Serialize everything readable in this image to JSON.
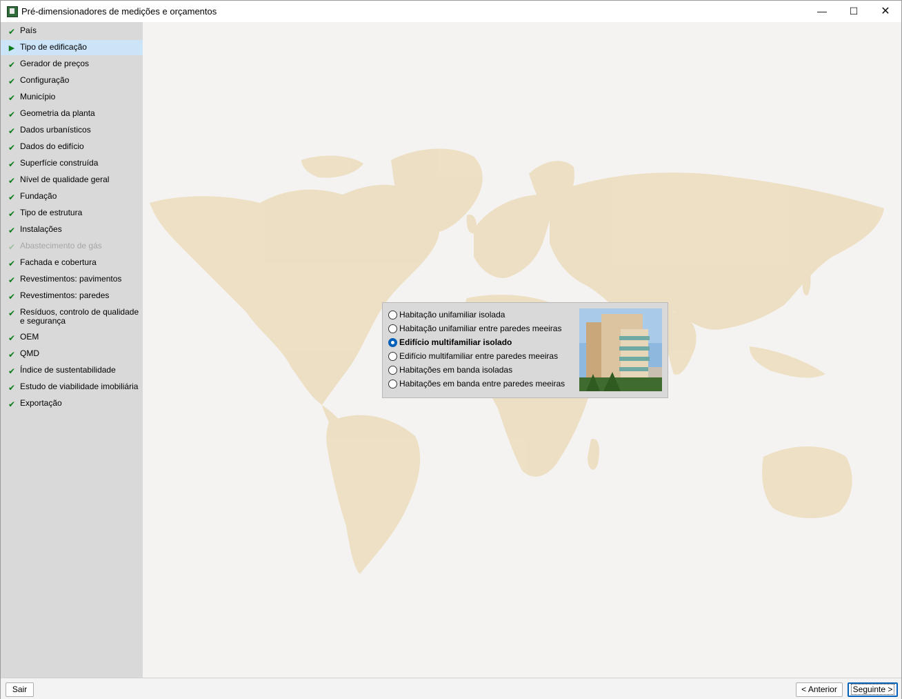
{
  "window": {
    "title": "Pré-dimensionadores de medições e orçamentos",
    "controls": {
      "minimize": "—",
      "maximize": "☐",
      "close": "✕"
    }
  },
  "sidebar": {
    "items": [
      {
        "label": "País",
        "status": "done"
      },
      {
        "label": "Tipo de edificação",
        "status": "current"
      },
      {
        "label": "Gerador de preços",
        "status": "done"
      },
      {
        "label": "Configuração",
        "status": "done"
      },
      {
        "label": "Município",
        "status": "done"
      },
      {
        "label": "Geometria da planta",
        "status": "done"
      },
      {
        "label": "Dados urbanísticos",
        "status": "done"
      },
      {
        "label": "Dados do edifício",
        "status": "done"
      },
      {
        "label": "Superfície construída",
        "status": "done"
      },
      {
        "label": "Nível de qualidade geral",
        "status": "done"
      },
      {
        "label": "Fundação",
        "status": "done"
      },
      {
        "label": "Tipo de estrutura",
        "status": "done"
      },
      {
        "label": "Instalações",
        "status": "done"
      },
      {
        "label": "Abastecimento de gás",
        "status": "disabled"
      },
      {
        "label": "Fachada e cobertura",
        "status": "done"
      },
      {
        "label": "Revestimentos: pavimentos",
        "status": "done"
      },
      {
        "label": "Revestimentos: paredes",
        "status": "done"
      },
      {
        "label": "Resíduos, controlo de qualidade e segurança",
        "status": "done"
      },
      {
        "label": "OEM",
        "status": "done"
      },
      {
        "label": "QMD",
        "status": "done"
      },
      {
        "label": "Índice de sustentabilidade",
        "status": "done"
      },
      {
        "label": "Estudo de viabilidade imobiliária",
        "status": "done"
      },
      {
        "label": "Exportação",
        "status": "done"
      }
    ],
    "icons": {
      "done": "✔",
      "current": "▶"
    }
  },
  "building_type": {
    "options": [
      {
        "label": "Habitação unifamiliar isolada",
        "selected": false
      },
      {
        "label": "Habitação unifamiliar entre paredes meeiras",
        "selected": false
      },
      {
        "label": "Edifício multifamiliar isolado",
        "selected": true
      },
      {
        "label": "Edifício multifamiliar entre paredes meeiras",
        "selected": false
      },
      {
        "label": "Habitações em banda isoladas",
        "selected": false
      },
      {
        "label": "Habitações em banda entre paredes meeiras",
        "selected": false
      }
    ],
    "photo_icon": "building-photo"
  },
  "footer": {
    "exit_label": "Sair",
    "prev_label": "< Anterior",
    "next_label": "Seguinte >"
  },
  "colors": {
    "sidebar_bg": "#d9d9d9",
    "selected_bg": "#cce4f7",
    "check_green": "#0a7a1a",
    "map_land": "#ecdcbc",
    "accent": "#005fb8"
  }
}
